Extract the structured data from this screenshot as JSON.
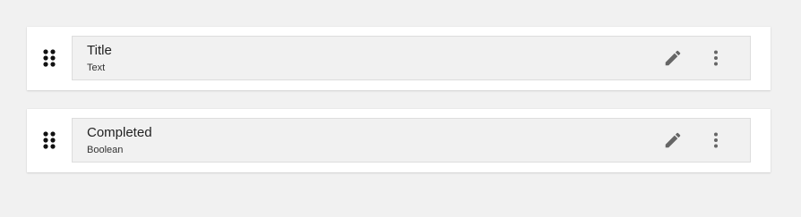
{
  "colors": {
    "page_background": "#f1f1f1",
    "card_background": "#ffffff",
    "field_background": "#f1f1f1",
    "icon": "#666666",
    "drag_icon": "#111111"
  },
  "fields": [
    {
      "name": "Title",
      "type": "Text",
      "drag_icon": "drag-handle-icon",
      "edit_icon": "pencil-icon",
      "menu_icon": "more-vertical-icon"
    },
    {
      "name": "Completed",
      "type": "Boolean",
      "drag_icon": "drag-handle-icon",
      "edit_icon": "pencil-icon",
      "menu_icon": "more-vertical-icon"
    }
  ]
}
